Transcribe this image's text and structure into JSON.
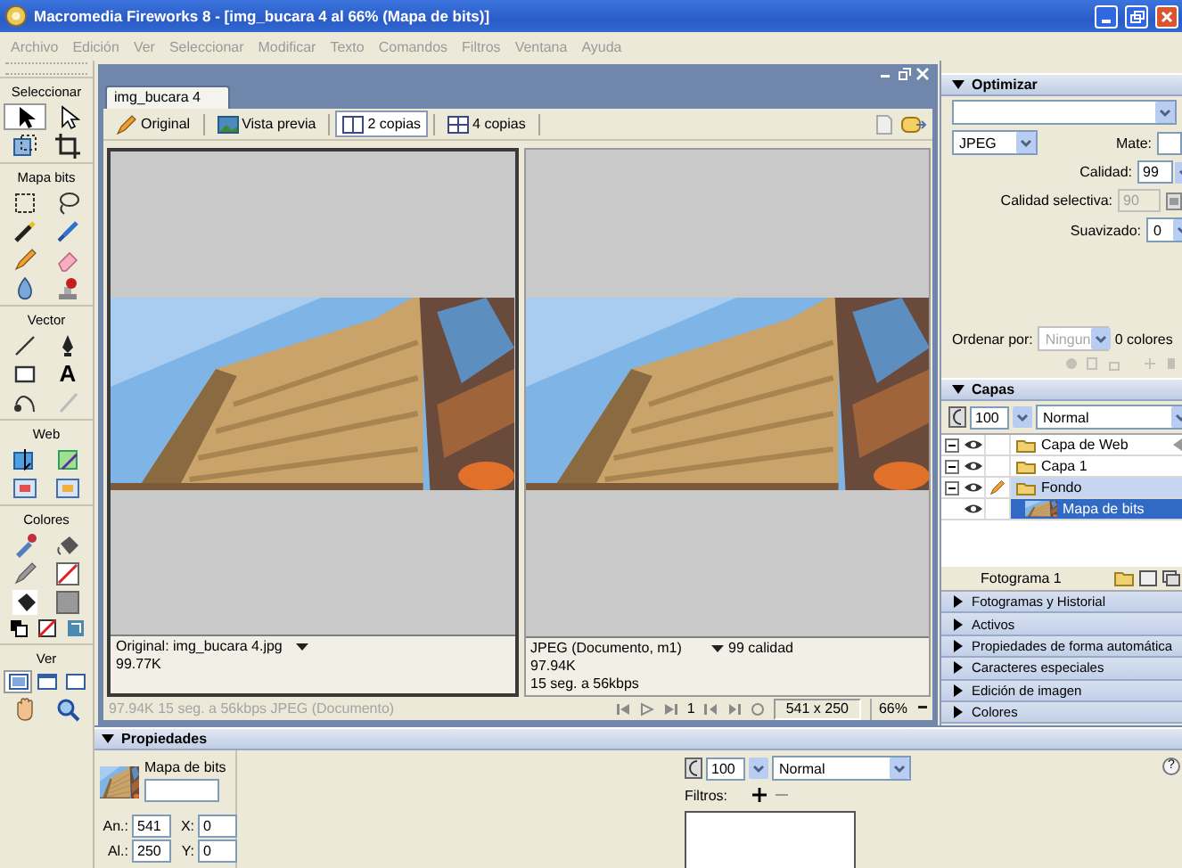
{
  "window": {
    "title": "Macromedia Fireworks 8 - [img_bucara 4 al  66% (Mapa de bits)]"
  },
  "menu": [
    "Archivo",
    "Edición",
    "Ver",
    "Seleccionar",
    "Modificar",
    "Texto",
    "Comandos",
    "Filtros",
    "Ventana",
    "Ayuda"
  ],
  "toolbox": {
    "sections": [
      {
        "label": "Seleccionar",
        "tools": [
          {
            "kind": "pointer",
            "selected": true
          },
          {
            "kind": "subselect",
            "selected": false
          },
          {
            "kind": "scale",
            "selected": false
          },
          {
            "kind": "crop",
            "selected": false
          }
        ]
      },
      {
        "label": "Mapa bits",
        "tools": [
          {
            "kind": "marquee",
            "selected": false
          },
          {
            "kind": "lasso",
            "selected": false
          },
          {
            "kind": "wand",
            "selected": false
          },
          {
            "kind": "brush",
            "selected": false
          },
          {
            "kind": "pencil",
            "selected": false
          },
          {
            "kind": "eraser",
            "selected": false
          },
          {
            "kind": "blur",
            "selected": false
          },
          {
            "kind": "stamp",
            "selected": false
          }
        ]
      },
      {
        "label": "Vector",
        "tools": [
          {
            "kind": "line",
            "selected": false
          },
          {
            "kind": "pen",
            "selected": false
          },
          {
            "kind": "rectangle",
            "selected": false
          },
          {
            "kind": "text",
            "glyph": "A",
            "selected": false
          },
          {
            "kind": "freeform",
            "selected": false
          },
          {
            "kind": "knife",
            "selected": false
          }
        ]
      },
      {
        "label": "Web",
        "tools": [
          {
            "kind": "hotspot",
            "selected": false
          },
          {
            "kind": "slice",
            "selected": false
          },
          {
            "kind": "hide-slices",
            "selected": false
          },
          {
            "kind": "show-slices",
            "selected": false
          }
        ]
      },
      {
        "label": "Colores",
        "tools": [
          {
            "kind": "eyedropper",
            "selected": false
          },
          {
            "kind": "bucket",
            "selected": false
          },
          {
            "kind": "stroke-pencil",
            "selected": false
          },
          {
            "kind": "stroke-swatch",
            "selected": false
          },
          {
            "kind": "fill-bucket",
            "selected": false
          },
          {
            "kind": "fill-swatch",
            "selected": false
          },
          {
            "kind": "default-colors",
            "selected": false
          },
          {
            "kind": "no-stroke",
            "selected": false
          },
          {
            "kind": "swap-colors",
            "selected": false
          }
        ]
      },
      {
        "label": "Ver",
        "tools": [
          {
            "kind": "mode-standard",
            "selected": true
          },
          {
            "kind": "mode-menus",
            "selected": false
          },
          {
            "kind": "mode-full",
            "selected": false
          },
          {
            "kind": "hand",
            "selected": false
          },
          {
            "kind": "zoom",
            "selected": false
          }
        ]
      }
    ]
  },
  "document": {
    "tab": "img_bucara 4",
    "views": [
      {
        "label": "Original",
        "selected": false
      },
      {
        "label": "Vista previa",
        "selected": false
      },
      {
        "label": "2 copias",
        "selected": true
      },
      {
        "label": "4 copias",
        "selected": false
      }
    ],
    "panes": [
      {
        "selected": true,
        "info": [
          "Original: img_bucara 4.jpg",
          "99.77K"
        ]
      },
      {
        "selected": false,
        "info": [
          "JPEG (Documento, m1)",
          "97.94K",
          "15 seg. a 56kbps"
        ],
        "quality": "99 calidad"
      }
    ],
    "status": {
      "summary": "97.94K  15 seg. a 56kbps  JPEG (Documento)",
      "frame": "1",
      "dimensions": "541 x 250",
      "zoom": "66%"
    }
  },
  "optimize": {
    "title": "Optimizar",
    "expanded": true,
    "format": "JPEG",
    "matte_label": "Mate:",
    "fields": [
      {
        "label": "Calidad:",
        "value": "99",
        "kind": "slider",
        "disabled": false
      },
      {
        "label": "Calidad selectiva:",
        "value": "90",
        "kind": "button",
        "disabled": true
      },
      {
        "label": "Suavizado:",
        "value": "0",
        "kind": "dropdown",
        "disabled": false
      }
    ],
    "sort_label": "Ordenar por:",
    "sort": {
      "value": "Ningun",
      "disabled": true
    },
    "color_count": "0 colores"
  },
  "layers": {
    "title": "Capas",
    "expanded": true,
    "opacity": "100",
    "blend": "Normal",
    "items": [
      {
        "name": "Capa de Web",
        "kind": "web",
        "expanded": true,
        "selected": false
      },
      {
        "name": "Capa 1",
        "kind": "folder",
        "expanded": true,
        "selected": false
      },
      {
        "name": "Fondo",
        "kind": "folder",
        "expanded": true,
        "selected": true,
        "children": [
          {
            "name": "Mapa de bits",
            "kind": "bitmap",
            "selected": true
          }
        ]
      }
    ],
    "frame": "Fotograma 1"
  },
  "collapsed_panels": [
    {
      "title": "Fotogramas y Historial",
      "expanded": false
    },
    {
      "title": "Activos",
      "expanded": false
    },
    {
      "title": "Propiedades de forma automática",
      "expanded": false
    },
    {
      "title": "Caracteres especiales",
      "expanded": false
    },
    {
      "title": "Edición de imagen",
      "expanded": false
    },
    {
      "title": "Colores",
      "expanded": false
    }
  ],
  "properties": {
    "title": "Propiedades",
    "expanded": true,
    "object": "Mapa de bits",
    "geometry": [
      {
        "label": "An.:",
        "value": "541"
      },
      {
        "label": "X:",
        "value": "0"
      },
      {
        "label": "Al.:",
        "value": "250"
      },
      {
        "label": "Y:",
        "value": "0"
      }
    ],
    "opacity": "100",
    "blend": "Normal",
    "filters_label": "Filtros:",
    "help": "?"
  }
}
